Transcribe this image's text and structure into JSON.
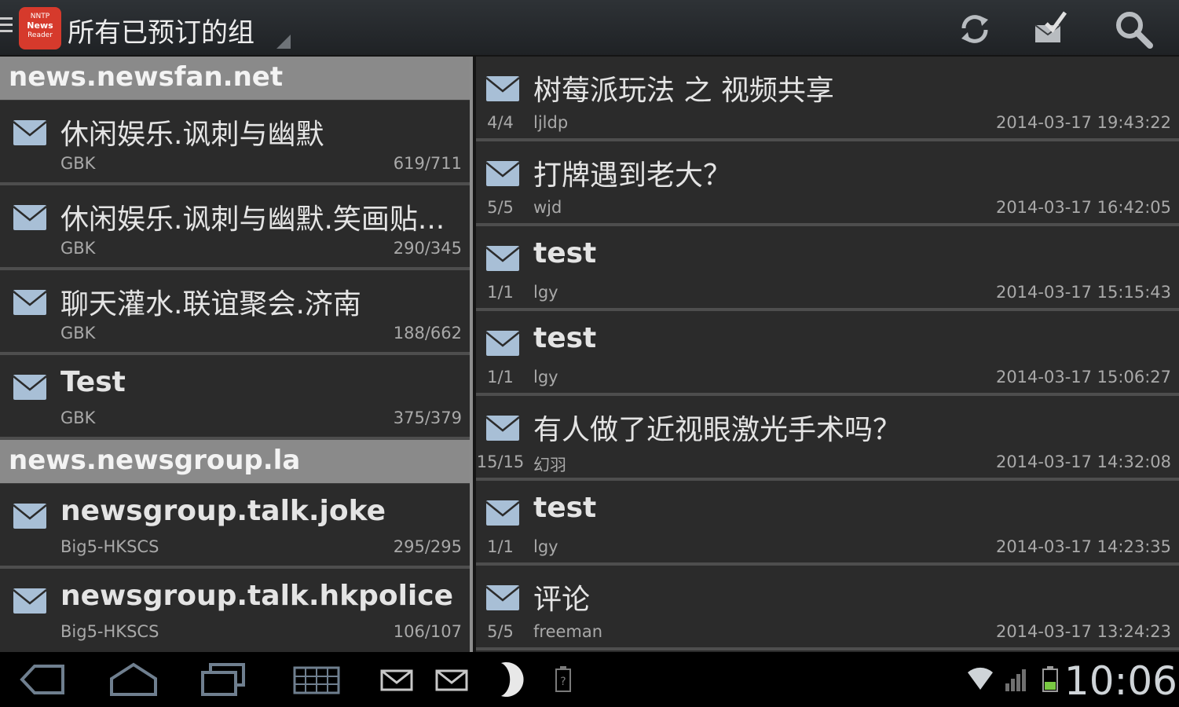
{
  "actionbar": {
    "title": "所有已预订的组",
    "logo_text_line1": "NNTP",
    "logo_text_line2": "News",
    "logo_text_line3": "Reader",
    "icons": [
      "drawer-icon",
      "refresh-icon",
      "mark-read-icon",
      "search-icon"
    ]
  },
  "servers": [
    {
      "name": "news.newsfan.net",
      "groups": [
        {
          "name": "休闲娱乐.讽刺与幽默",
          "encoding": "GBK",
          "count": "619/711"
        },
        {
          "name": "休闲娱乐.讽刺与幽默.笑画贴...",
          "encoding": "GBK",
          "count": "290/345"
        },
        {
          "name": "聊天灌水.联谊聚会.济南",
          "encoding": "GBK",
          "count": "188/662"
        },
        {
          "name": "Test",
          "encoding": "GBK",
          "count": "375/379"
        }
      ]
    },
    {
      "name": "news.newsgroup.la",
      "groups": [
        {
          "name": "newsgroup.talk.joke",
          "encoding": "Big5-HKSCS",
          "count": "295/295"
        },
        {
          "name": "newsgroup.talk.hkpolice",
          "encoding": "Big5-HKSCS",
          "count": "106/107"
        }
      ]
    }
  ],
  "threads": [
    {
      "subject": "树莓派玩法 之 视频共享",
      "count": "4/4",
      "author": "ljldp",
      "date": "2014-03-17 19:43:22"
    },
    {
      "subject": "打牌遇到老大？",
      "count": "5/5",
      "author": "wjd",
      "date": "2014-03-17 16:42:05"
    },
    {
      "subject": "test",
      "count": "1/1",
      "author": "lgy",
      "date": "2014-03-17 15:15:43"
    },
    {
      "subject": "test",
      "count": "1/1",
      "author": "lgy",
      "date": "2014-03-17 15:06:27"
    },
    {
      "subject": "有人做了近视眼激光手术吗？",
      "count": "15/15",
      "author": "幻羽",
      "date": "2014-03-17 14:32:08"
    },
    {
      "subject": "test",
      "count": "1/1",
      "author": "lgy",
      "date": "2014-03-17 14:23:35"
    },
    {
      "subject": "评论",
      "count": "5/5",
      "author": "freeman",
      "date": "2014-03-17 13:24:23"
    }
  ],
  "systembar": {
    "clock": "10:06",
    "icons": [
      "back-icon",
      "home-icon",
      "recent-apps-icon",
      "keyboard-icon",
      "mail-notification-icon",
      "mail-notification-icon",
      "moon-icon",
      "battery-saver-icon",
      "wifi-icon",
      "signal-icon",
      "battery-icon"
    ]
  },
  "colors": {
    "actionbar_bg": "#2a2d30",
    "pane_bg": "#2b2b2b",
    "header_bg": "#8a8a8a",
    "divider": "#4e4e4e",
    "logo_red": "#d63a2c",
    "envelope_blue": "#a8bfd6"
  }
}
